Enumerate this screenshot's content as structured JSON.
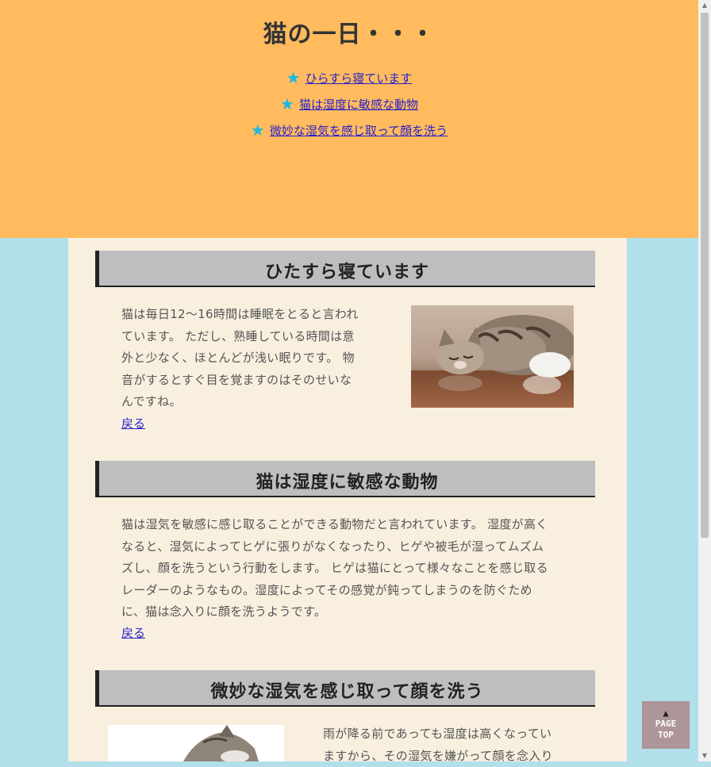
{
  "header": {
    "title": "猫の一日・・・",
    "toc": [
      {
        "label": "ひらすら寝ています"
      },
      {
        "label": "猫は湿度に敏感な動物"
      },
      {
        "label": "微妙な湿気を感じ取って顔を洗う"
      }
    ],
    "star_icon": "★"
  },
  "sections": [
    {
      "heading": "ひたすら寝ています",
      "lines": [
        "猫は毎日12～16時間は睡眠をとると言われ",
        "ています。 ただし、熟睡している時間は意",
        "外と少なく、ほとんどが浅い眠りです。 物",
        "音がするとすぐ目を覚ますのはそのせいな",
        "んですね。"
      ],
      "back": "戻る",
      "photo": "sleeping-cat-photo"
    },
    {
      "heading": "猫は湿度に敏感な動物",
      "lines": [
        "猫は湿気を敏感に感じ取ることができる動物だと言われています。 湿度が高く",
        "なると、湿気によってヒゲに張りがなくなったり、ヒゲや被毛が湿ってムズム",
        "ズし、顔を洗うという行動をします。 ヒゲは猫にとって様々なことを感じ取る",
        "レーダーのようなもの。湿度によってその感覚が鈍ってしまうのを防ぐため",
        "に、猫は念入りに顔を洗うようです。"
      ],
      "back": "戻る"
    },
    {
      "heading": "微妙な湿気を感じ取って顔を洗う",
      "lines": [
        "雨が降る前であっても湿度は高くなってい",
        "ますから、その湿気を嫌がって顔を念入り"
      ],
      "photo": "cat-face-photo"
    }
  ],
  "pagetop": {
    "line1": "PAGE",
    "line2": "TOP",
    "arrow": "▲"
  },
  "colors": {
    "header_bg": "#ffbb5e",
    "page_bg": "#b1e0ea",
    "content_bg": "#f8efde",
    "heading_bg": "#bebebe",
    "link": "#2a1fcc",
    "star": "#1ab7e0"
  }
}
